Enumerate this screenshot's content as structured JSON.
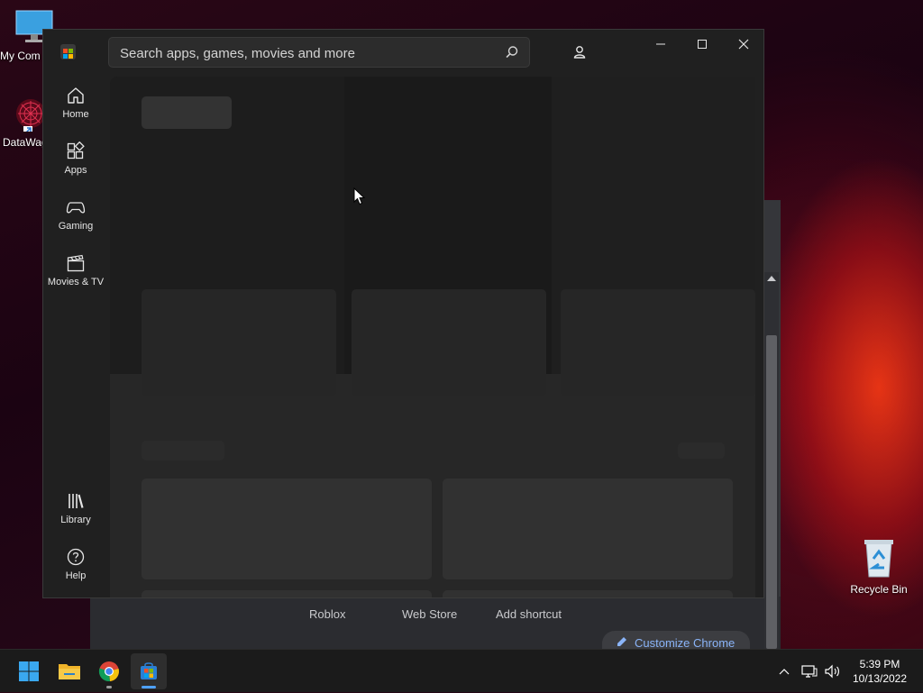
{
  "desktop": {
    "icons": [
      {
        "label": "My Com",
        "name": "my-computer"
      },
      {
        "label": "DataWag",
        "name": "datawag"
      },
      {
        "label": "Recycle Bin",
        "name": "recycle-bin"
      }
    ]
  },
  "chrome": {
    "shortcuts": [
      "Roblox",
      "Web Store",
      "Add shortcut"
    ],
    "customize_label": "Customize Chrome"
  },
  "store": {
    "search": {
      "placeholder": "Search apps, games, movies and more"
    },
    "nav": [
      {
        "label": "Home",
        "icon": "home-icon"
      },
      {
        "label": "Apps",
        "icon": "apps-icon"
      },
      {
        "label": "Gaming",
        "icon": "gamepad-icon"
      },
      {
        "label": "Movies & TV",
        "icon": "clapperboard-icon"
      }
    ],
    "nav_bottom": [
      {
        "label": "Library",
        "icon": "library-icon"
      },
      {
        "label": "Help",
        "icon": "help-icon"
      }
    ]
  },
  "taskbar": {
    "apps": [
      "start",
      "file-explorer",
      "chrome",
      "microsoft-store"
    ],
    "time": "5:39 PM",
    "date": "10/13/2022"
  }
}
